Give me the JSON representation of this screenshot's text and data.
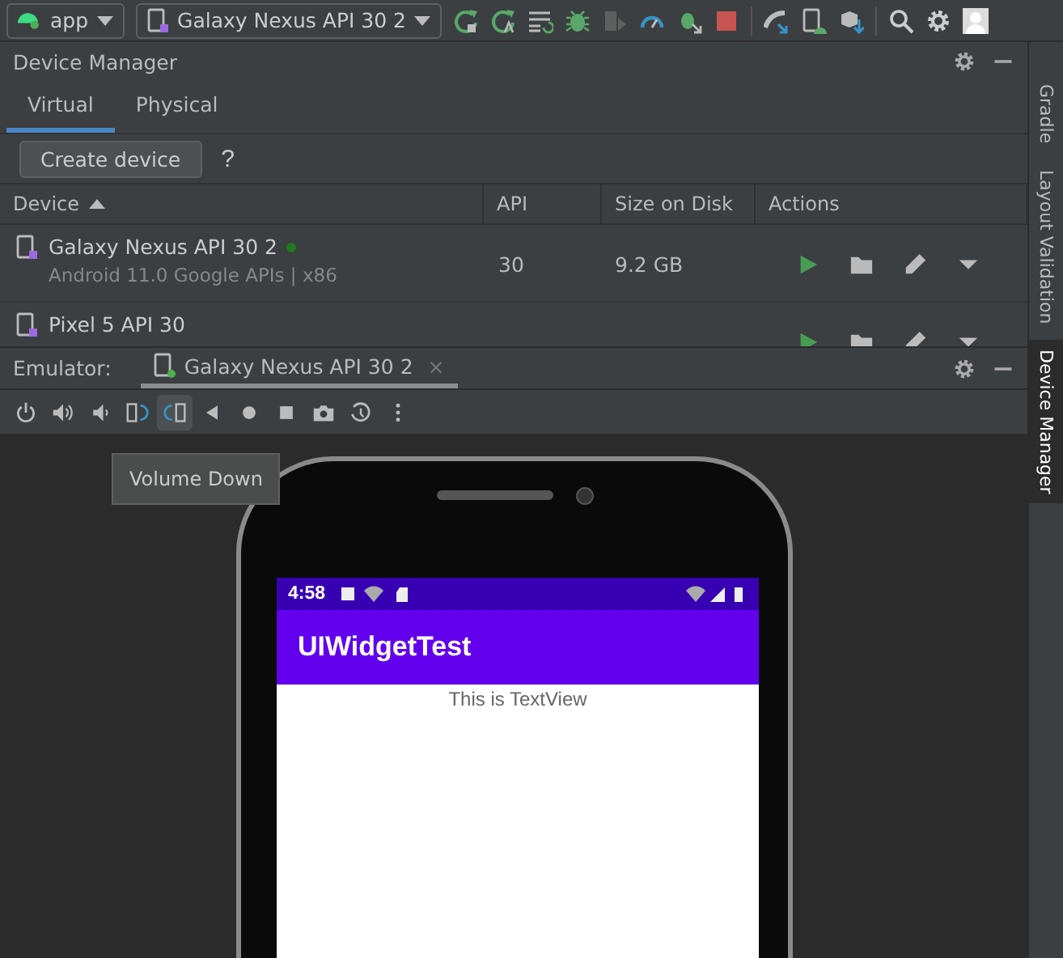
{
  "toolbar": {
    "run_config": "app",
    "device": "Galaxy Nexus API 30 2"
  },
  "device_manager": {
    "title": "Device Manager",
    "tabs": [
      {
        "label": "Virtual",
        "selected": true
      },
      {
        "label": "Physical",
        "selected": false
      }
    ],
    "create_button": "Create device",
    "help": "?",
    "columns": [
      "Device",
      "API",
      "Size on Disk",
      "Actions"
    ],
    "rows": [
      {
        "name": "Galaxy Nexus API 30 2",
        "online": true,
        "details": "Android 11.0 Google APIs | x86",
        "api": "30",
        "size": "9.2 GB"
      },
      {
        "name": "Pixel 5 API 30",
        "online": false
      }
    ]
  },
  "emulator": {
    "label": "Emulator:",
    "tab": "Galaxy Nexus API 30 2",
    "tab_close": "×",
    "tools": [
      {
        "kind": "power",
        "selected": false
      },
      {
        "kind": "volume-up",
        "selected": false
      },
      {
        "kind": "volume-down",
        "selected": false
      },
      {
        "kind": "rotate-left",
        "selected": false
      },
      {
        "kind": "rotate-right",
        "selected": true
      },
      {
        "kind": "back",
        "selected": false
      },
      {
        "kind": "home",
        "selected": false
      },
      {
        "kind": "overview",
        "selected": false
      },
      {
        "kind": "screenshot",
        "selected": false
      },
      {
        "kind": "snapshot",
        "selected": false
      },
      {
        "kind": "more",
        "selected": false
      }
    ],
    "tooltip": "Volume Down"
  },
  "phone": {
    "time": "4:58",
    "app_title": "UIWidgetTest",
    "text": "This is TextView"
  },
  "side_tabs": [
    {
      "label": "Gradle",
      "selected": false
    },
    {
      "label": "Layout Validation",
      "selected": false
    },
    {
      "label": "Device Manager",
      "selected": true
    }
  ]
}
